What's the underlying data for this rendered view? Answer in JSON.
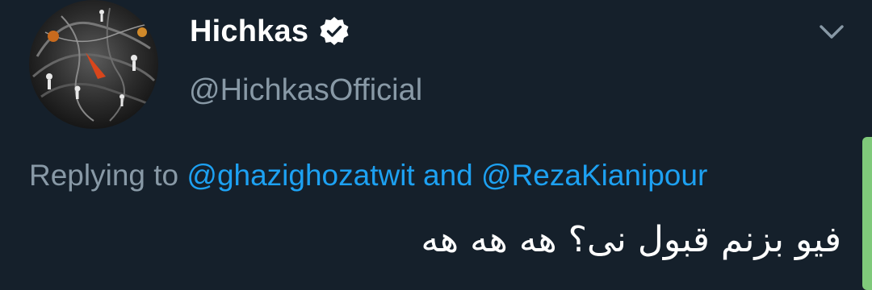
{
  "author": {
    "display_name": "Hichkas",
    "handle": "@HichkasOfficial",
    "verified": true
  },
  "reply_context": {
    "prefix": "Replying to",
    "mention_1": "@ghazighozatwit",
    "conjunction": "and",
    "mention_2": "@RezaKianipour"
  },
  "tweet": {
    "text": "فیو بزنم قبول نی؟ هه هه هه"
  },
  "icons": {
    "verified": "verified-check-icon",
    "menu": "chevron-down-icon"
  },
  "colors": {
    "background": "#15202b",
    "primary_text": "#ffffff",
    "secondary_text": "#8899a6",
    "link": "#1da1f2",
    "accent_bar": "#7fc97a"
  }
}
